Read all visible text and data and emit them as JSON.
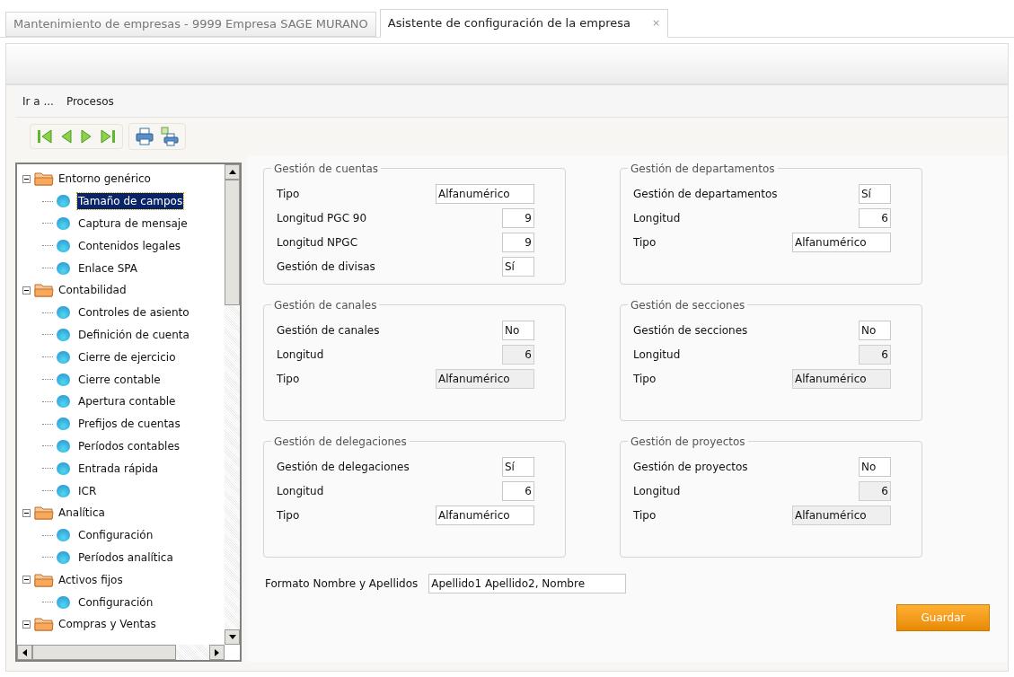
{
  "tabs": [
    {
      "label": "Mantenimiento de empresas - 9999 Empresa SAGE MURANO",
      "selected": false
    },
    {
      "label": "Asistente de configuración de la empresa",
      "selected": true,
      "close": "×"
    }
  ],
  "menu": [
    "Ir a ...",
    "Procesos"
  ],
  "tree": [
    {
      "label": "Entorno genérico",
      "expanded": true,
      "children": [
        {
          "label": "Tamaño de campos",
          "selected": true
        },
        {
          "label": "Captura de mensaje",
          "selected": false
        },
        {
          "label": "Contenidos legales",
          "selected": false
        },
        {
          "label": "Enlace SPA",
          "selected": false
        }
      ]
    },
    {
      "label": "Contabilidad",
      "expanded": true,
      "children": [
        {
          "label": "Controles de asiento",
          "selected": false
        },
        {
          "label": "Definición de cuenta",
          "selected": false
        },
        {
          "label": "Cierre de ejercicio",
          "selected": false
        },
        {
          "label": "Cierre contable",
          "selected": false
        },
        {
          "label": "Apertura contable",
          "selected": false
        },
        {
          "label": "Prefijos de cuentas",
          "selected": false
        },
        {
          "label": "Períodos contables",
          "selected": false
        },
        {
          "label": "Entrada rápida",
          "selected": false
        },
        {
          "label": "ICR",
          "selected": false
        }
      ]
    },
    {
      "label": "Analítica",
      "expanded": true,
      "children": [
        {
          "label": "Configuración",
          "selected": false
        },
        {
          "label": "Períodos analítica",
          "selected": false
        }
      ]
    },
    {
      "label": "Activos fijos",
      "expanded": true,
      "children": [
        {
          "label": "Configuración",
          "selected": false
        }
      ]
    },
    {
      "label": "Compras y Ventas",
      "expanded": true
    }
  ],
  "groups": [
    {
      "title": "Gestión de cuentas",
      "fields": [
        {
          "label": "Tipo",
          "value": "Alfanumérico",
          "kind": "text",
          "disabled": false
        },
        {
          "label": "Longitud PGC 90",
          "value": "9",
          "kind": "number",
          "disabled": false
        },
        {
          "label": "Longitud NPGC",
          "value": "9",
          "kind": "number",
          "disabled": false
        },
        {
          "label": "Gestión de divisas",
          "value": "Sí",
          "kind": "flag",
          "disabled": false
        }
      ]
    },
    {
      "title": "Gestión de departamentos",
      "fields": [
        {
          "label": "Gestión de departamentos",
          "value": "Sí",
          "kind": "flag",
          "disabled": false
        },
        {
          "label": "Longitud",
          "value": "6",
          "kind": "number",
          "disabled": false
        },
        {
          "label": "Tipo",
          "value": "Alfanumérico",
          "kind": "text",
          "disabled": false
        }
      ]
    },
    {
      "title": "Gestión de canales",
      "fields": [
        {
          "label": "Gestión de canales",
          "value": "No",
          "kind": "flag",
          "disabled": false
        },
        {
          "label": "Longitud",
          "value": "6",
          "kind": "number",
          "disabled": true
        },
        {
          "label": "Tipo",
          "value": "Alfanumérico",
          "kind": "text",
          "disabled": true
        }
      ]
    },
    {
      "title": "Gestión de secciones",
      "fields": [
        {
          "label": "Gestión de secciones",
          "value": "No",
          "kind": "flag",
          "disabled": false
        },
        {
          "label": "Longitud",
          "value": "6",
          "kind": "number",
          "disabled": true
        },
        {
          "label": "Tipo",
          "value": "Alfanumérico",
          "kind": "text",
          "disabled": true
        }
      ]
    },
    {
      "title": "Gestión de delegaciones",
      "fields": [
        {
          "label": "Gestión de delegaciones",
          "value": "Sí",
          "kind": "flag",
          "disabled": false
        },
        {
          "label": "Longitud",
          "value": "6",
          "kind": "number",
          "disabled": false
        },
        {
          "label": "Tipo",
          "value": "Alfanumérico",
          "kind": "text",
          "disabled": false
        }
      ]
    },
    {
      "title": "Gestión de proyectos",
      "fields": [
        {
          "label": "Gestión de proyectos",
          "value": "No",
          "kind": "flag",
          "disabled": false
        },
        {
          "label": "Longitud",
          "value": "6",
          "kind": "number",
          "disabled": true
        },
        {
          "label": "Tipo",
          "value": "Alfanumérico",
          "kind": "text",
          "disabled": true
        }
      ]
    }
  ],
  "name_format": {
    "label": "Formato Nombre y Apellidos",
    "value": "Apellido1 Apellido2, Nombre"
  },
  "save_button": "Guardar"
}
